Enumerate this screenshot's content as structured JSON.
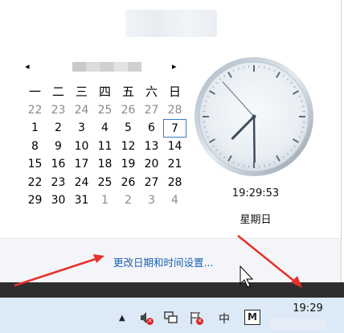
{
  "calendar": {
    "prev_arrow": "◂",
    "next_arrow": "▸",
    "weekdays": [
      "一",
      "二",
      "三",
      "四",
      "五",
      "六",
      "日"
    ],
    "weeks": [
      [
        "22",
        "23",
        "24",
        "25",
        "26",
        "27",
        "28"
      ],
      [
        "1",
        "2",
        "3",
        "4",
        "5",
        "6",
        "7"
      ],
      [
        "8",
        "9",
        "10",
        "11",
        "12",
        "13",
        "14"
      ],
      [
        "15",
        "16",
        "17",
        "18",
        "19",
        "20",
        "21"
      ],
      [
        "22",
        "23",
        "24",
        "25",
        "26",
        "27",
        "28"
      ],
      [
        "29",
        "30",
        "31",
        "1",
        "2",
        "3",
        "4"
      ]
    ],
    "other_month": [
      [
        0,
        0
      ],
      [
        0,
        1
      ],
      [
        0,
        2
      ],
      [
        0,
        3
      ],
      [
        0,
        4
      ],
      [
        0,
        5
      ],
      [
        0,
        6
      ],
      [
        5,
        3
      ],
      [
        5,
        4
      ],
      [
        5,
        5
      ],
      [
        5,
        6
      ]
    ],
    "today": [
      1,
      6
    ]
  },
  "clock": {
    "time": "19:29:53",
    "day": "星期日",
    "hours": 19,
    "minutes": 29,
    "seconds": 53
  },
  "footer": {
    "change_settings_link": "更改日期和时间设置..."
  },
  "taskbar": {
    "show_hidden": "▲",
    "ime_label": "中",
    "ime_mode": "M",
    "clock": "19:29"
  },
  "colors": {
    "link": "#1a5fb4",
    "today_border": "#3a78c2",
    "annotation_arrow": "#e8312a",
    "taskbar": "#dce9f6"
  }
}
